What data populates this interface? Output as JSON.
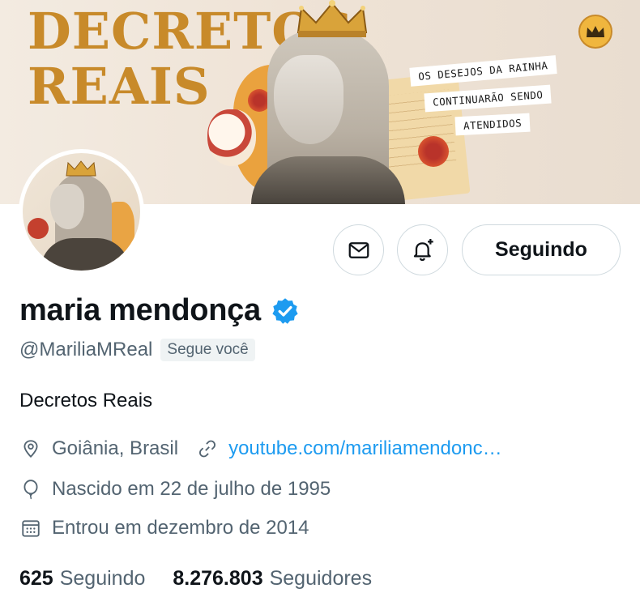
{
  "banner": {
    "title_line1": "DECRETOS",
    "title_line2": "REAIS",
    "quote_lines": [
      "OS DESEJOS DA RAINHA",
      "CONTINUARÃO SENDO",
      "ATENDIDOS"
    ],
    "title_color": "#c88a2a"
  },
  "profile": {
    "display_name": "maria mendonça",
    "handle": "@MariliaMReal",
    "follows_you_badge": "Segue você",
    "bio": "Decretos Reais",
    "location": "Goiânia, Brasil",
    "website": "youtube.com/mariliamendonc…",
    "birthday": "Nascido em 22 de julho de 1995",
    "joined": "Entrou em dezembro de 2014",
    "verified_color": "#1d9bf0"
  },
  "actions": {
    "message_icon": "envelope-icon",
    "notify_icon": "bell-plus-icon",
    "follow_button_label": "Seguindo"
  },
  "stats": {
    "following_count": "625",
    "following_label": "Seguindo",
    "followers_count": "8.276.803",
    "followers_label": "Seguidores"
  },
  "colors": {
    "link": "#1d9bf0",
    "secondary_text": "#536471",
    "border": "#cfd9de"
  }
}
